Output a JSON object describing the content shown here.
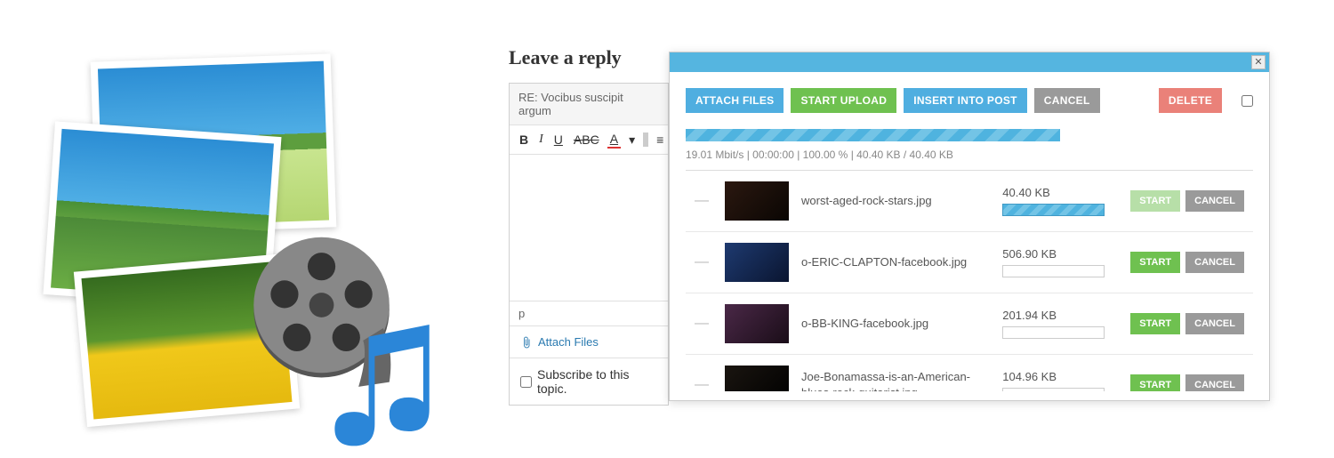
{
  "media_icons": {
    "photo1": "landscape-sky-field",
    "photo2": "landscape-tree",
    "photo3": "yellow-flowers",
    "reel": "film-reel",
    "note": "music-note"
  },
  "reply": {
    "title": "Leave a reply",
    "subject": "RE: Vocibus suscipit argum",
    "path_marker": "p",
    "attach_link": "Attach Files",
    "subscribe_label": "Subscribe to this topic.",
    "toolbar": {
      "bold": "B",
      "italic": "I",
      "underline": "U",
      "strike": "ABC",
      "fontcolor": "A",
      "ul": "≡",
      "ol": "≡",
      "outdent": "≡",
      "indent": "≡"
    }
  },
  "upload": {
    "close": "✕",
    "buttons": {
      "attach": "ATTACH FILES",
      "start_upload": "START UPLOAD",
      "insert": "INSERT INTO POST",
      "cancel": "CANCEL",
      "delete": "DELETE"
    },
    "stats": "19.01 Mbit/s | 00:00:00 | 100.00 % | 40.40 KB / 40.40 KB",
    "files": [
      {
        "name": "worst-aged-rock-stars.jpg",
        "size": "40.40 KB",
        "progress": true,
        "start_disabled": true,
        "thumb": "thumb-dark"
      },
      {
        "name": "o-ERIC-CLAPTON-facebook.jpg",
        "size": "506.90 KB",
        "progress": false,
        "start_disabled": false,
        "thumb": "thumb-blue"
      },
      {
        "name": "o-BB-KING-facebook.jpg",
        "size": "201.94 KB",
        "progress": false,
        "start_disabled": false,
        "thumb": "thumb-bb"
      },
      {
        "name": "Joe-Bonamassa-is-an-American-blues-rock-guitarist.jpg",
        "size": "104.96 KB",
        "progress": false,
        "start_disabled": false,
        "thumb": "thumb-joe"
      }
    ],
    "row_labels": {
      "start": "START",
      "cancel": "CANCEL"
    }
  }
}
